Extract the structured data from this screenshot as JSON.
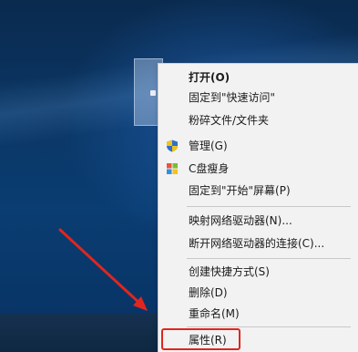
{
  "context_menu": {
    "items": [
      {
        "label": "打开(O)",
        "bold": true
      },
      {
        "label": "固定到\"快速访问\""
      },
      {
        "label": "粉碎文件/文件夹"
      },
      {
        "label": "管理(G)",
        "icon": "shield-icon"
      },
      {
        "label": "C盘瘦身",
        "icon": "windows-logo-icon"
      },
      {
        "label": "固定到\"开始\"屏幕(P)"
      },
      {
        "label": "映射网络驱动器(N)..."
      },
      {
        "label": "断开网络驱动器的连接(C)..."
      },
      {
        "label": "创建快捷方式(S)"
      },
      {
        "label": "删除(D)"
      },
      {
        "label": "重命名(M)"
      },
      {
        "label": "属性(R)"
      }
    ]
  },
  "annotation": {
    "arrow_color": "#e0261f",
    "highlight_color": "#e0261f",
    "highlighted_item": "属性(R)"
  },
  "colors": {
    "menu_background": "#f2f2f2",
    "desktop_blue": "#0b3766",
    "shield_blue": "#2f6fd0",
    "shield_yellow": "#f0c419"
  }
}
